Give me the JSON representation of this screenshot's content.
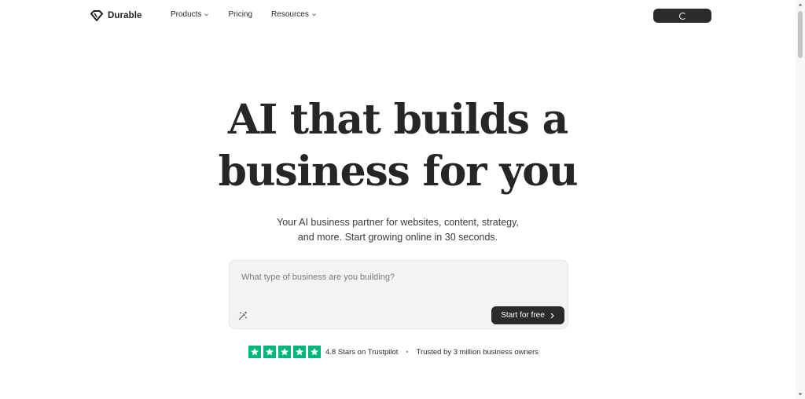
{
  "header": {
    "brand": "Durable",
    "nav": [
      {
        "label": "Products",
        "has_dropdown": true
      },
      {
        "label": "Pricing",
        "has_dropdown": false
      },
      {
        "label": "Resources",
        "has_dropdown": true
      }
    ],
    "cta_state": "loading"
  },
  "hero": {
    "title_line1": "AI that builds a",
    "title_line2": "business for you",
    "subtitle_line1": "Your AI business partner for websites, content, strategy,",
    "subtitle_line2": "and more. Start growing online in 30 seconds."
  },
  "prompt": {
    "placeholder": "What type of business are you building?",
    "value": "",
    "button_label": "Start for free"
  },
  "trust": {
    "stars": 5,
    "rating_text": "4.8 Stars on Trustpilot",
    "separator": "•",
    "trusted_text": "Trusted by 3 million business owners"
  },
  "colors": {
    "dark": "#2b2b2b",
    "trustpilot_green": "#00b67a",
    "input_bg": "#f3f3f3"
  },
  "icons": {
    "logo": "diamond-logo-icon",
    "dropdown": "chevron-down-icon",
    "wand": "magic-wand-icon",
    "button_arrow": "chevron-right-icon",
    "star": "star-icon"
  }
}
